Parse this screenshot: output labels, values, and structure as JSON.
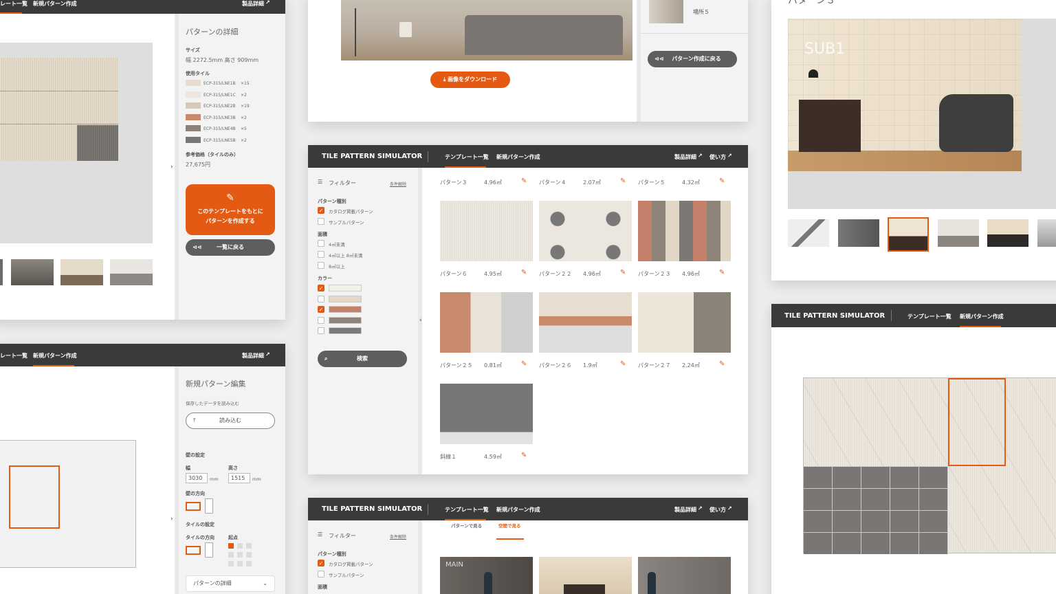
{
  "p1": {
    "nav_templates": "レート一覧",
    "nav_new": "新規パターン作成",
    "nav_product": "製品詳細",
    "title": "パターンの詳細",
    "size_label": "サイズ",
    "size_value": "幅 2272.5mm 高さ 909mm",
    "tiles_label": "使用タイル",
    "tiles": [
      {
        "code": "ECP-315/LNE1B",
        "count": "×15",
        "color": "#e6dccf"
      },
      {
        "code": "ECP-315/LNE1C",
        "count": "×2",
        "color": "#efe7dd"
      },
      {
        "code": "ECP-315/LNE2B",
        "count": "×19",
        "color": "#d8c8b4"
      },
      {
        "code": "ECP-315/LNE3B",
        "count": "×2",
        "color": "#c98a6c"
      },
      {
        "code": "ECP-315/LNE4B",
        "count": "×5",
        "color": "#8d8276"
      },
      {
        "code": "ECP-315/LNE5B",
        "count": "×2",
        "color": "#7a7674"
      }
    ],
    "price_label": "参考価格（タイルのみ）",
    "price_value": "27,675円",
    "create_label_1": "このテンプレートをもとに",
    "create_label_2": "パターンを作成する",
    "back_label": "一覧に戻る"
  },
  "p2": {
    "download_label": "画像をダウンロード",
    "place_label": "場所５",
    "back_label": "パターン作成に戻る"
  },
  "p3": {
    "title": "パターン３"
  },
  "sim": {
    "brand": "TILE PATTERN SIMULATOR",
    "nav_templates": "テンプレート一覧",
    "nav_new": "新規パターン作成",
    "nav_product": "製品詳細",
    "nav_howto": "使い方",
    "filter_label": "フィルター",
    "reset_label": "条件解除",
    "type_label": "パターン種別",
    "type_catalog": "カタログ掲載パターン",
    "type_sample": "サンプルパターン",
    "area_label": "面積",
    "area_opts": [
      "4㎡未満",
      "4㎡以上 8㎡未満",
      "8㎡以上"
    ],
    "color_label": "カラー",
    "colors": [
      "#f4f1ec",
      "#e3d8c8",
      "#c4816a",
      "#8e8477",
      "#7c7a78"
    ],
    "search_label": "検索",
    "patterns": [
      {
        "name": "パターン３",
        "area": "4.96㎡"
      },
      {
        "name": "パターン４",
        "area": "2.07㎡"
      },
      {
        "name": "パターン５",
        "area": "4.32㎡"
      },
      {
        "name": "パターン６",
        "area": "4.95㎡"
      },
      {
        "name": "パターン２２",
        "area": "4.96㎡"
      },
      {
        "name": "パターン２３",
        "area": "4.96㎡"
      },
      {
        "name": "パターン２５",
        "area": "0.81㎡"
      },
      {
        "name": "パターン２６",
        "area": "1.9㎡"
      },
      {
        "name": "パターン２７",
        "area": "2.24㎡"
      },
      {
        "name": "斜線１",
        "area": "4.59㎡"
      }
    ]
  },
  "p5": {
    "nav_templates": "レート一覧",
    "nav_new": "新規パターン作成",
    "nav_product": "製品詳細",
    "title": "新規パターン編集",
    "load_label": "保存したデータを読み込む",
    "load_button": "読み込む",
    "wall_label": "壁の設定",
    "width_label": "幅",
    "height_label": "高さ",
    "width_value": "3030",
    "height_value": "1515",
    "unit": "mm",
    "orient_label": "壁の方向",
    "tile_label": "タイルの設定",
    "tile_orient_label": "タイルの方向",
    "origin_label": "起点",
    "details_label": "パターンの詳細"
  },
  "p6": {
    "brand": "TILE PATTERN SIMULATOR",
    "nav_templates": "テンプレート一覧",
    "nav_new": "新規パターン作成",
    "nav_product": "製品詳細",
    "nav_howto": "使い方",
    "tab_pattern": "パターンで見る",
    "tab_space": "空間で見る",
    "filter_label": "フィルター",
    "reset_label": "条件解除",
    "type_label": "パターン種別",
    "type_catalog": "カタログ掲載パターン",
    "type_sample": "サンプルパターン",
    "area_label": "面積",
    "main_label": "MAIN"
  },
  "p7": {
    "brand": "TILE PATTERN SIMULATOR",
    "nav_templates": "テンプレート一覧",
    "nav_new": "新規パターン作成"
  },
  "room": {
    "sub_label": "SUB1"
  },
  "accent": "#e55a12"
}
